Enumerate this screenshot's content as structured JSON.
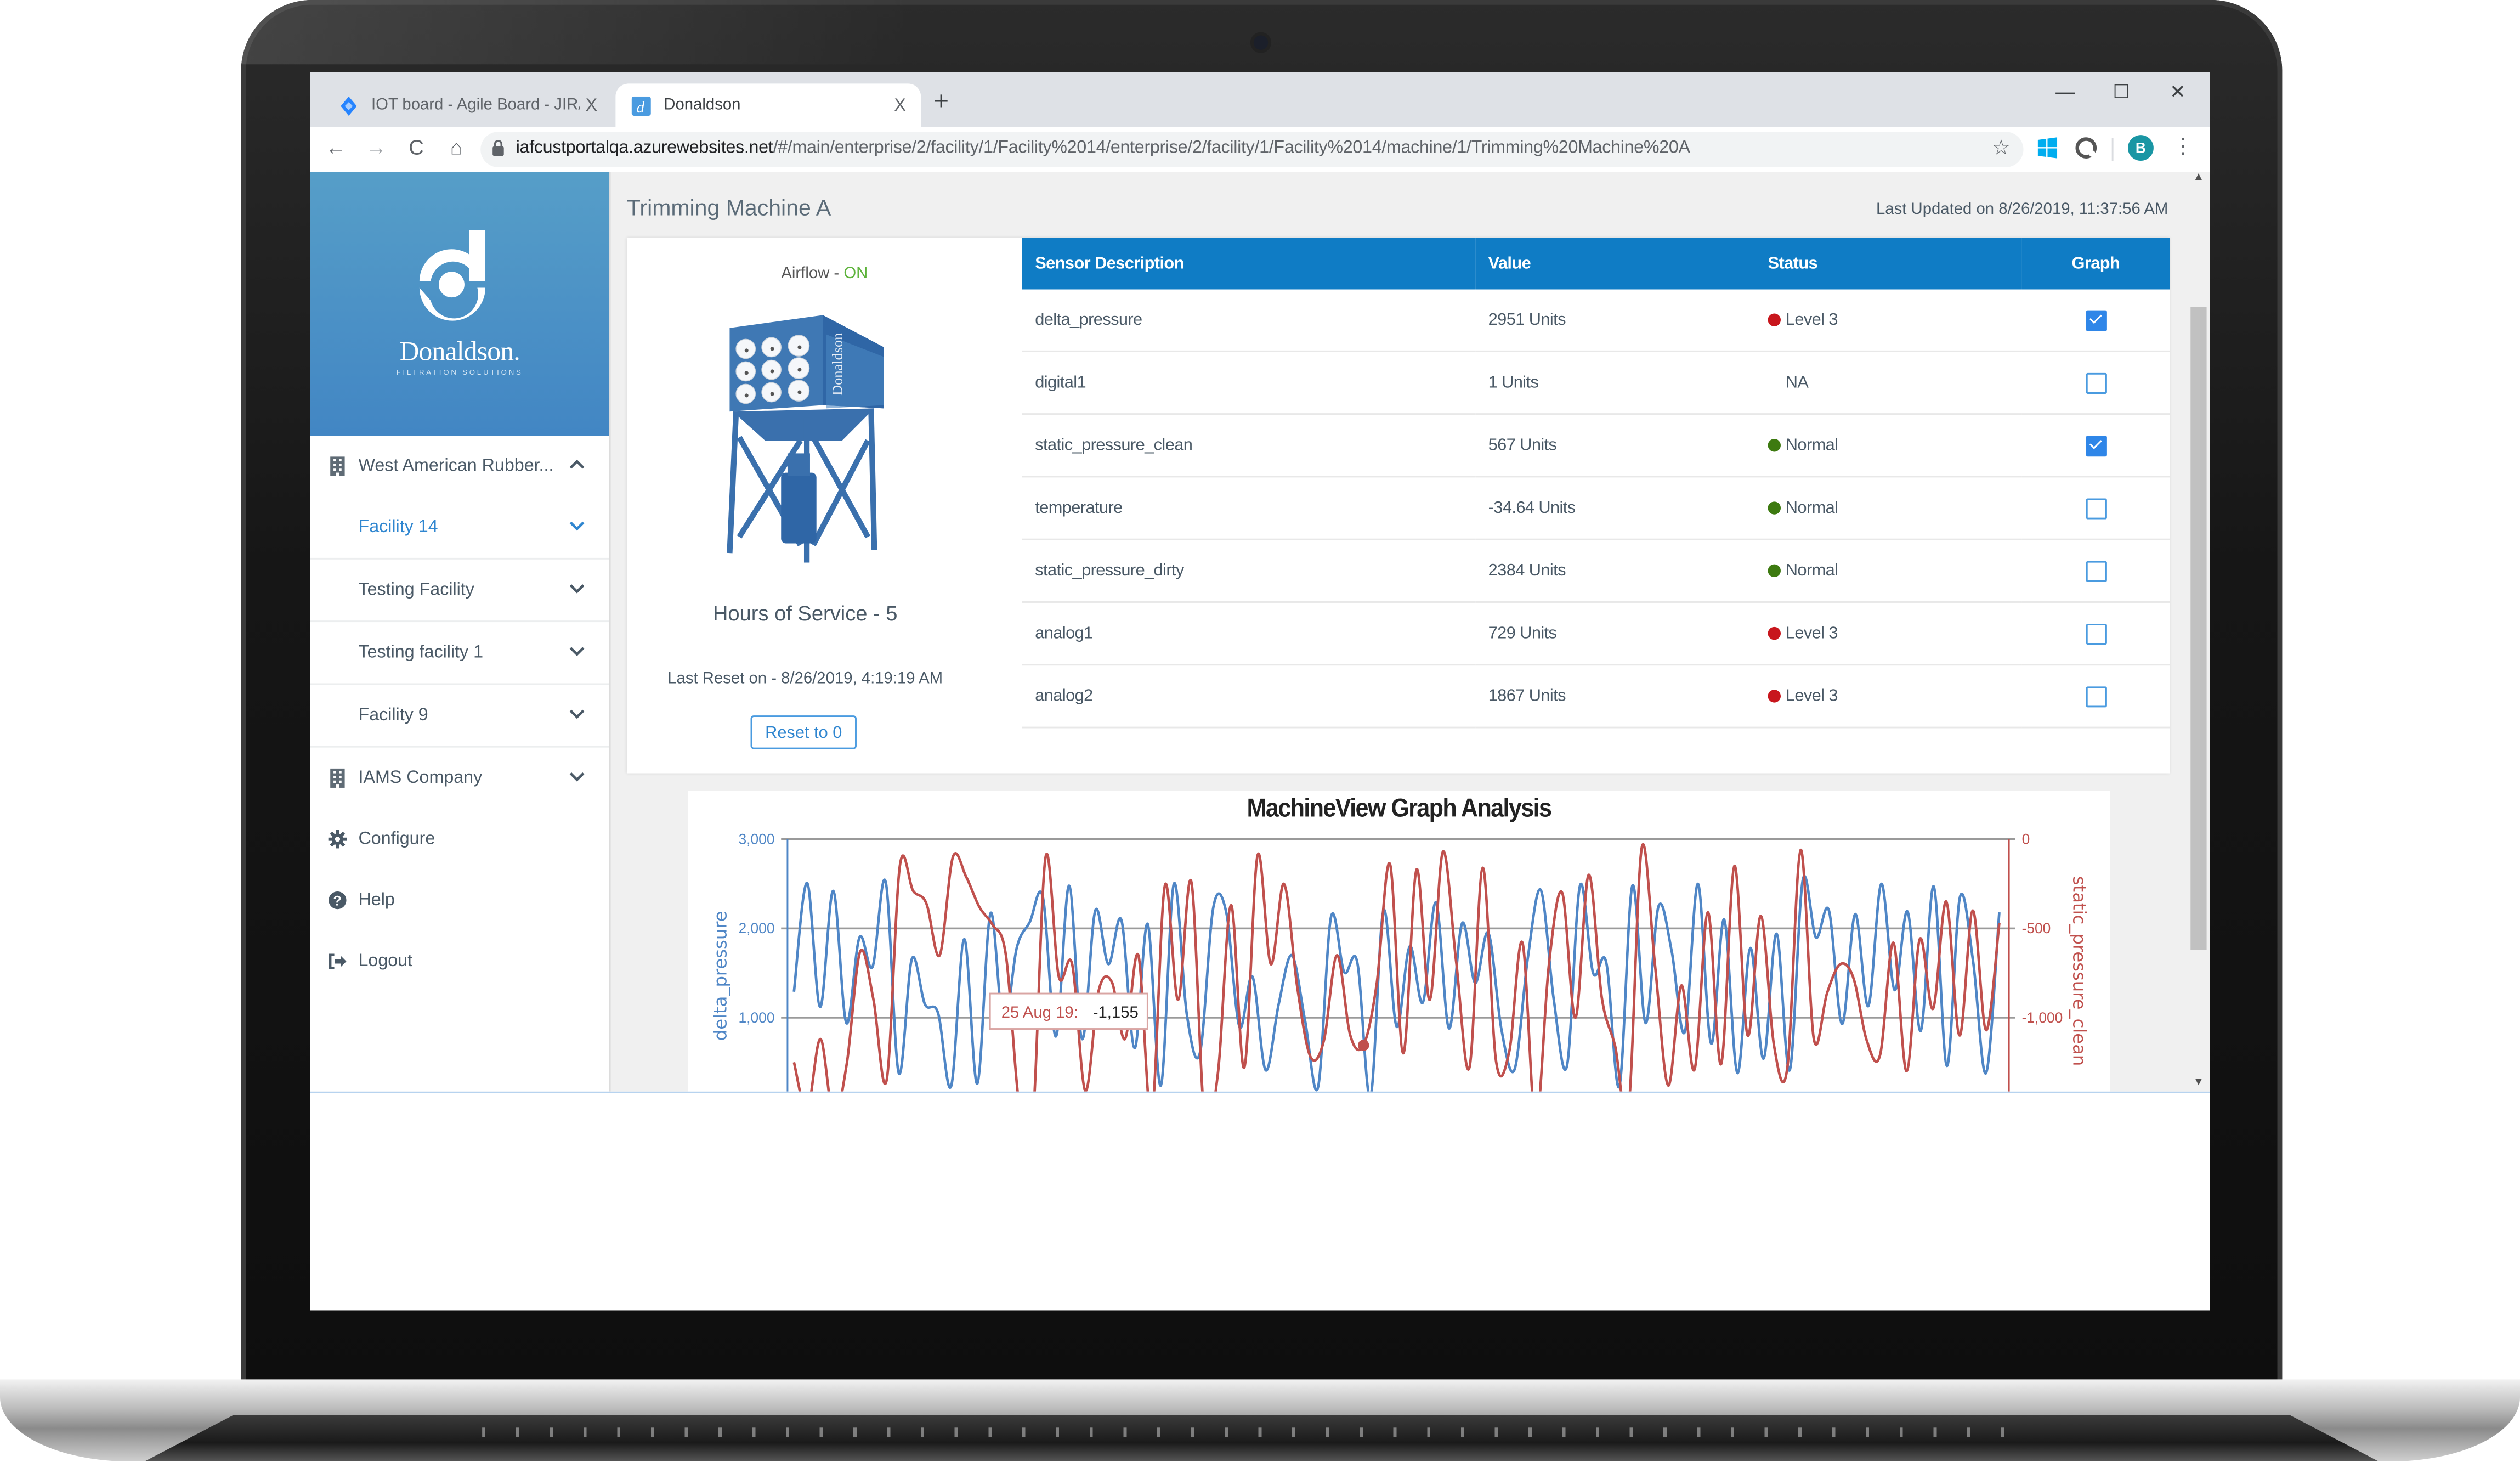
{
  "browser": {
    "tabs": [
      {
        "label": "IOT board - Agile Board - JIRA",
        "icon": "jira-diamond-icon",
        "active": false
      },
      {
        "label": "Donaldson",
        "icon": "donaldson-d-icon",
        "active": true
      }
    ],
    "close_glyph": "X",
    "new_tab_glyph": "+",
    "window_controls": {
      "minimize": "—",
      "maximize": "☐",
      "close": "✕"
    },
    "nav": {
      "back": "←",
      "forward": "→",
      "reload": "C",
      "home": "⌂"
    },
    "url_host": "iafcustportalqa.azurewebsites.net",
    "url_path": "/#/main/enterprise/2/facility/1/Facility%2014/enterprise/2/facility/1/Facility%2014/machine/1/Trimming%20Machine%20A",
    "bookmark_glyph": "☆",
    "profile_initial": "B",
    "menu_glyph": "⋮",
    "colors": {
      "profile": "#1a96a4",
      "windows_ext": "#00adef"
    }
  },
  "brand": {
    "name": "Donaldson.",
    "tagline": "FILTRATION SOLUTIONS",
    "gradient_top": "#569ec8",
    "gradient_bottom": "#4286c4"
  },
  "sidebar": {
    "items": [
      {
        "label": "West American Rubber...",
        "icon": "building-icon",
        "chevron": "up",
        "level": "top",
        "active": false
      },
      {
        "label": "Facility 14",
        "icon": null,
        "chevron": "down",
        "level": "sub",
        "active": true
      },
      {
        "label": "Testing Facility",
        "icon": null,
        "chevron": "down",
        "level": "sub",
        "active": false
      },
      {
        "label": "Testing facility 1",
        "icon": null,
        "chevron": "down",
        "level": "sub",
        "active": false
      },
      {
        "label": "Facility 9",
        "icon": null,
        "chevron": "down",
        "level": "sub",
        "active": false
      },
      {
        "label": "IAMS Company",
        "icon": "building-icon",
        "chevron": "down",
        "level": "top",
        "active": false
      },
      {
        "label": "Configure",
        "icon": "gear-icon",
        "chevron": null,
        "level": "top",
        "active": false
      },
      {
        "label": "Help",
        "icon": "help-circle-icon",
        "chevron": null,
        "level": "top",
        "active": false
      },
      {
        "label": "Logout",
        "icon": "logout-icon",
        "chevron": null,
        "level": "top",
        "active": false
      }
    ],
    "active_color": "#2f86d0"
  },
  "main": {
    "machine_title": "Trimming Machine A",
    "last_updated": "Last Updated on 8/26/2019, 11:37:56 AM",
    "machine": {
      "airflow_label": "Airflow - ",
      "airflow_status": "ON",
      "airflow_color": "#5db33b",
      "image": "dust-collector-illustration",
      "hours_of_service": "Hours of Service - 5",
      "last_reset": "Last Reset on - 8/26/2019, 4:19:19 AM",
      "reset_button": "Reset to 0"
    },
    "table": {
      "header_color": "#0f7cc5",
      "columns": [
        "Sensor Description",
        "Value",
        "Status",
        "Graph"
      ],
      "rows": [
        {
          "sensor": "delta_pressure",
          "value": "2951 Units",
          "status": "Level 3",
          "status_color": "#c8161d",
          "graph": true
        },
        {
          "sensor": "digital1",
          "value": "1 Units",
          "status": "NA",
          "status_color": null,
          "graph": false
        },
        {
          "sensor": "static_pressure_clean",
          "value": "567 Units",
          "status": "Normal",
          "status_color": "#3d7a10",
          "graph": true
        },
        {
          "sensor": "temperature",
          "value": "-34.64 Units",
          "status": "Normal",
          "status_color": "#3d7a10",
          "graph": false
        },
        {
          "sensor": "static_pressure_dirty",
          "value": "2384 Units",
          "status": "Normal",
          "status_color": "#3d7a10",
          "graph": false
        },
        {
          "sensor": "analog1",
          "value": "729 Units",
          "status": "Level 3",
          "status_color": "#c8161d",
          "graph": false
        },
        {
          "sensor": "analog2",
          "value": "1867 Units",
          "status": "Level 3",
          "status_color": "#c8161d",
          "graph": false
        }
      ]
    }
  },
  "chart_data": {
    "type": "line",
    "title": "MachineView Graph Analysis",
    "xlabel": "",
    "grid": true,
    "legend": "none",
    "y_left": {
      "label": "delta_pressure",
      "ticks": [
        "3,000",
        "2,000",
        "1,000"
      ],
      "tick_values": [
        3000,
        2000,
        1000
      ],
      "range": [
        0,
        3000
      ],
      "color": "#4f86c6"
    },
    "y_right": {
      "label": "static_pressure_clean",
      "ticks": [
        "0",
        "-500",
        "-1,000"
      ],
      "tick_values": [
        0,
        -500,
        -1000
      ],
      "range": [
        -1650,
        0
      ],
      "color": "#c0504d"
    },
    "tooltip": {
      "label": "25 Aug 19:",
      "value": "-1,155",
      "series": "static_pressure_clean",
      "index": 43
    },
    "series": [
      {
        "name": "delta_pressure",
        "axis": "left",
        "color": "#4f86c6",
        "values": [
          1290,
          2510,
          1120,
          2420,
          940,
          1900,
          1570,
          2520,
          380,
          1660,
          1150,
          1050,
          230,
          1880,
          260,
          2170,
          900,
          1780,
          2070,
          2350,
          790,
          2480,
          760,
          2200,
          1600,
          2090,
          660,
          2050,
          240,
          2500,
          1020,
          610,
          2230,
          2180,
          900,
          1460,
          410,
          1150,
          1700,
          980,
          220,
          2130,
          1510,
          1620,
          110,
          2200,
          900,
          1800,
          1170,
          2290,
          880,
          2060,
          1390,
          1950,
          870,
          420,
          1650,
          2430,
          1200,
          460,
          2480,
          1500,
          1620,
          230,
          2480,
          940,
          2250,
          1740,
          840,
          2500,
          710,
          2100,
          380,
          1780,
          540,
          1940,
          410,
          2540,
          1900,
          2200,
          930,
          2160,
          1130,
          2500,
          1310,
          2190,
          850,
          2470,
          460,
          2350,
          1630,
          380,
          2180
        ]
      },
      {
        "name": "static_pressure_clean",
        "axis": "right",
        "color": "#c0504d",
        "values": [
          -1250,
          -1520,
          -1120,
          -1560,
          -1250,
          -630,
          -900,
          -1350,
          -150,
          -290,
          -360,
          -650,
          -100,
          -210,
          -380,
          -480,
          -650,
          -1480,
          -1600,
          -100,
          -770,
          -700,
          -1410,
          -850,
          -800,
          -1120,
          -650,
          -1550,
          -260,
          -900,
          -240,
          -1560,
          -1320,
          -370,
          -1280,
          -90,
          -700,
          -250,
          -830,
          -1220,
          -1130,
          -650,
          -1100,
          -1155,
          -810,
          -140,
          -1200,
          -170,
          -900,
          -70,
          -690,
          -1280,
          -160,
          -1240,
          -1190,
          -580,
          -1590,
          -700,
          -300,
          -1000,
          -200,
          -890,
          -1160,
          -1520,
          -50,
          -700,
          -1380,
          -820,
          -1290,
          -410,
          -1260,
          -150,
          -1100,
          -430,
          -1160,
          -1280,
          -60,
          -1120,
          -860,
          -700,
          -780,
          -1130,
          -1210,
          -580,
          -1300,
          -560,
          -950,
          -350,
          -1100,
          -400,
          -1070,
          -470
        ]
      }
    ]
  }
}
